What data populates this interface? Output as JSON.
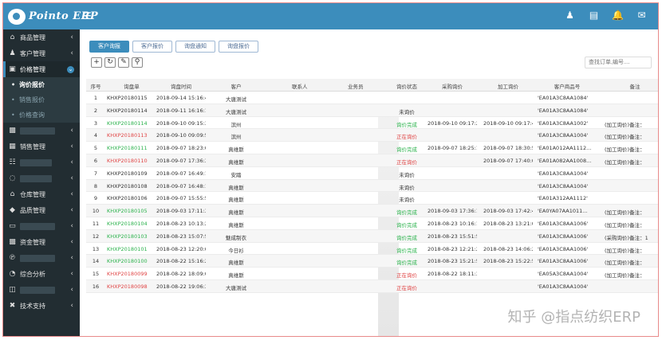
{
  "brand": {
    "logo_text": "Pointo ERP",
    "accent": "#3c8dbc",
    "sidebar_bg": "#222d32"
  },
  "topbar": {
    "menu_icon": "hamburger-icon",
    "icons": [
      "user-icon",
      "document-icon",
      "bell-icon",
      "mail-icon"
    ]
  },
  "sidebar": {
    "items": [
      {
        "label": "商品管理",
        "icon": "home-icon"
      },
      {
        "label": "客户管理",
        "icon": "user-icon"
      },
      {
        "label": "价格管理",
        "icon": "price-icon",
        "active": true
      },
      {
        "label": "",
        "icon": "inbox-icon"
      },
      {
        "label": "销售管理",
        "icon": "chart-icon"
      },
      {
        "label": "",
        "icon": "cart-icon"
      },
      {
        "label": "",
        "icon": "box-icon"
      },
      {
        "label": "仓库管理",
        "icon": "warehouse-icon"
      },
      {
        "label": "品质管理",
        "icon": "diamond-icon"
      },
      {
        "label": "",
        "icon": "trash-icon"
      },
      {
        "label": "资金管理",
        "icon": "money-icon"
      },
      {
        "label": "",
        "icon": "signal-icon"
      },
      {
        "label": "综合分析",
        "icon": "pie-icon"
      },
      {
        "label": "",
        "icon": "screen-icon"
      },
      {
        "label": "技术支持",
        "icon": "tools-icon"
      }
    ],
    "sub_items": [
      "询价报价",
      "销售报价",
      "价格查询"
    ]
  },
  "tabs": [
    "客户询报",
    "客户报价",
    "询盘通知",
    "询盘报价"
  ],
  "search": {
    "placeholder": "查找订单,编号...."
  },
  "table": {
    "headers": [
      "序号",
      "询盘单",
      "询盘时间",
      "客户",
      "联系人",
      "业务员",
      "询价状态",
      "采购询价",
      "加工询价",
      "客户商品号",
      "备注"
    ],
    "rows": [
      {
        "idx": "1",
        "no": "KHXP20180115",
        "date": "2018-09-14 15:16:43",
        "cust": "大唐测试",
        "status": "",
        "quote": "",
        "proc": "",
        "cno": "'EA01A3C8AA1084'",
        "note": "",
        "color": "dark"
      },
      {
        "idx": "2",
        "no": "KHXP20180114",
        "date": "2018-09-11 16:16:13",
        "cust": "大唐测试",
        "status": "未询价",
        "quote": "",
        "proc": "",
        "cno": "'EA01A3C8AA1084'",
        "note": "",
        "color": "dark"
      },
      {
        "idx": "3",
        "no": "KHXP20180114",
        "date": "2018-09-10 09:15:38",
        "cust": "滨州",
        "status": "询价完成",
        "quote": "2018-09-10 09:17:21",
        "proc": "2018-09-10 09:17:47",
        "cno": "'EA01A3C8AA1002'",
        "note": "(加工询价)备注：",
        "color": "green"
      },
      {
        "idx": "4",
        "no": "KHXP20180113",
        "date": "2018-09-10 09:09:59",
        "cust": "滨州",
        "status": "正在询价",
        "quote": "",
        "proc": "",
        "cno": "'EA01A3C8AA1004'",
        "note": "(加工询价)备注：",
        "color": "red"
      },
      {
        "idx": "5",
        "no": "KHXP20180111",
        "date": "2018-09-07 18:23:01",
        "cust": "真维斯",
        "status": "询价完成",
        "quote": "2018-09-07 18:25:19",
        "proc": "2018-09-07 18:30:50",
        "cno": "'EA01A012AA1112...",
        "note": "(加工询价)备注：",
        "color": "green"
      },
      {
        "idx": "6",
        "no": "KHXP20180110",
        "date": "2018-09-07 17:36:34",
        "cust": "真维斯",
        "status": "正在询价",
        "quote": "",
        "proc": "2018-09-07 17:40:00",
        "cno": "'EA01A082AA1008...",
        "note": "(加工询价)备注：",
        "color": "red"
      },
      {
        "idx": "7",
        "no": "KHXP20180109",
        "date": "2018-09-07 16:49:14",
        "cust": "安踏",
        "status": "未询价",
        "quote": "",
        "proc": "",
        "cno": "'EA01A3C8AA1004'",
        "note": "",
        "color": "dark"
      },
      {
        "idx": "8",
        "no": "KHXP20180108",
        "date": "2018-09-07 16:48:13",
        "cust": "真维斯",
        "status": "未询价",
        "quote": "",
        "proc": "",
        "cno": "'EA01A3C8AA1004'",
        "note": "",
        "color": "dark"
      },
      {
        "idx": "9",
        "no": "KHXP20180106",
        "date": "2018-09-07 15:55:57",
        "cust": "真维斯",
        "status": "未询价",
        "quote": "",
        "proc": "",
        "cno": "'EA01A312AA1112'",
        "note": "",
        "color": "dark"
      },
      {
        "idx": "10",
        "no": "KHXP20180105",
        "date": "2018-09-03 17:11:39",
        "cust": "真维斯",
        "status": "询价完成",
        "quote": "2018-09-03 17:36:14",
        "proc": "2018-09-03 17:42:40",
        "cno": "'EA0YA07AA1011...",
        "note": "(加工询价)备注：",
        "color": "green"
      },
      {
        "idx": "11",
        "no": "KHXP20180104",
        "date": "2018-08-23 10:13:26",
        "cust": "真维斯",
        "status": "询价完成",
        "quote": "2018-08-23 10:16:16",
        "proc": "2018-08-23 13:21:07",
        "cno": "'EA01A3C8AA1006'",
        "note": "(加工询价)备注：",
        "color": "green"
      },
      {
        "idx": "12",
        "no": "KHXP20180103",
        "date": "2018-08-23 15:07:53",
        "cust": "魅成制衣",
        "status": "询价完成",
        "quote": "2018-08-23 15:51:56",
        "proc": "",
        "cno": "'EA01A3C8AA1006'",
        "note": "(采购询价)备注：1",
        "color": "green"
      },
      {
        "idx": "13",
        "no": "KHXP20180101",
        "date": "2018-08-23 12:20:08",
        "cust": "今日衫",
        "status": "询价完成",
        "quote": "2018-08-23 12:21:23",
        "proc": "2018-08-23 14:06:22",
        "cno": "'EA01A3C8AA1006'",
        "note": "(加工询价)备注：",
        "color": "green"
      },
      {
        "idx": "14",
        "no": "KHXP20180100",
        "date": "2018-08-22 15:16:21",
        "cust": "真维斯",
        "status": "询价完成",
        "quote": "2018-08-23 15:21:52",
        "proc": "2018-08-23 15:22:55",
        "cno": "'EA01A3C8AA1006'",
        "note": "(加工询价)备注：",
        "color": "green"
      },
      {
        "idx": "15",
        "no": "KHXP20180099",
        "date": "2018-08-22 18:09:01",
        "cust": "真维斯",
        "status": "正在询价",
        "quote": "2018-08-22 18:11:34",
        "proc": "",
        "cno": "'EA05A3C8AA1004'",
        "note": "(加工询价)备注：",
        "color": "red"
      },
      {
        "idx": "16",
        "no": "KHXP20180098",
        "date": "2018-08-22 19:06:34",
        "cust": "大唐测试",
        "status": "正在询价",
        "quote": "",
        "proc": "",
        "cno": "'EA01A3C8AA1004'",
        "note": "",
        "color": "red"
      }
    ]
  },
  "watermark": "知乎 @指点纺织ERP"
}
